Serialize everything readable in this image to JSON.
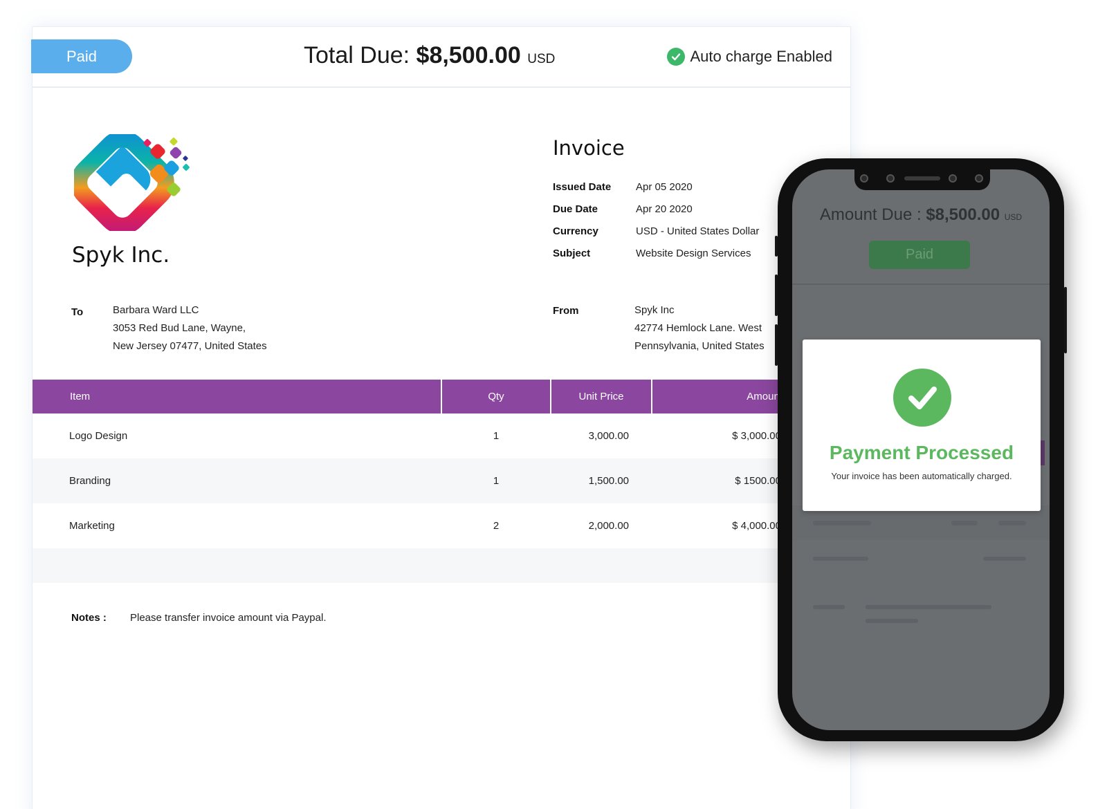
{
  "header": {
    "status_label": "Paid",
    "total_due_label": "Total Due:",
    "total_due_amount": "$8,500.00",
    "total_due_currency": "USD",
    "auto_charge_label": "Auto charge Enabled"
  },
  "company": {
    "name": "Spyk Inc."
  },
  "invoice": {
    "heading": "Invoice",
    "meta": [
      {
        "label": "Issued Date",
        "value": "Apr 05 2020"
      },
      {
        "label": "Due Date",
        "value": "Apr 20 2020"
      },
      {
        "label": "Currency",
        "value": "USD - United States Dollar"
      },
      {
        "label": "Subject",
        "value": "Website Design Services"
      }
    ]
  },
  "to": {
    "label": "To",
    "lines": [
      "Barbara Ward LLC",
      "3053 Red Bud Lane, Wayne,",
      "New Jersey 07477, United States"
    ]
  },
  "from": {
    "label": "From",
    "lines": [
      "Spyk Inc",
      "42774 Hemlock Lane. West",
      "Pennsylvania, United States"
    ]
  },
  "table": {
    "headers": [
      "Item",
      "Qty",
      "Unit Price",
      "Amount"
    ],
    "rows": [
      {
        "item": "Logo Design",
        "qty": "1",
        "unit_price": "3,000.00",
        "amount": "$ 3,000.00"
      },
      {
        "item": "Branding",
        "qty": "1",
        "unit_price": "1,500.00",
        "amount": "$ 1500.00"
      },
      {
        "item": "Marketing",
        "qty": "2",
        "unit_price": "2,000.00",
        "amount": "$ 4,000.00"
      }
    ]
  },
  "notes": {
    "label": "Notes :",
    "text": "Please transfer invoice amount via Paypal."
  },
  "phone": {
    "amount_label": "Amount Due :",
    "amount_value": "$8,500.00",
    "amount_currency": "USD",
    "status_label": "Paid",
    "modal": {
      "title": "Payment Processed",
      "subtitle": "Your invoice has been automatically charged."
    }
  },
  "colors": {
    "paid_pill": "#5aaeec",
    "table_header": "#8b479f",
    "success_green": "#5cb85f",
    "auto_charge_check": "#3db76a"
  },
  "icons": [
    "check-circle-icon",
    "spyk-logo",
    "success-check-icon"
  ]
}
